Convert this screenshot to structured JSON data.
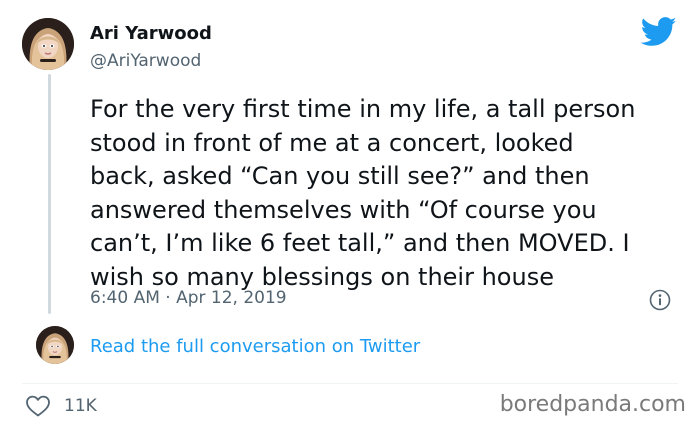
{
  "user": {
    "display_name": "Ari Yarwood",
    "handle": "@AriYarwood"
  },
  "tweet": {
    "text": "For the very first time in my life, a tall person\nstood in front of me at a concert, looked\nback, asked “Can you still see?” and then\nanswered themselves with “Of course you\ncan’t, I’m like 6 feet tall,” and then MOVED. I\nwish so many blessings on their house",
    "timestamp": "6:40 AM · Apr 12, 2019"
  },
  "conversation_link": "Read the full conversation on Twitter",
  "likes": "11K",
  "watermark": "boredpanda.com",
  "icons": {
    "brand": "twitter-bird-icon",
    "info": "info-icon",
    "like": "heart-icon"
  },
  "colors": {
    "twitter_blue": "#1d9bf0",
    "text_primary": "#0f1419",
    "text_secondary": "#536471"
  }
}
